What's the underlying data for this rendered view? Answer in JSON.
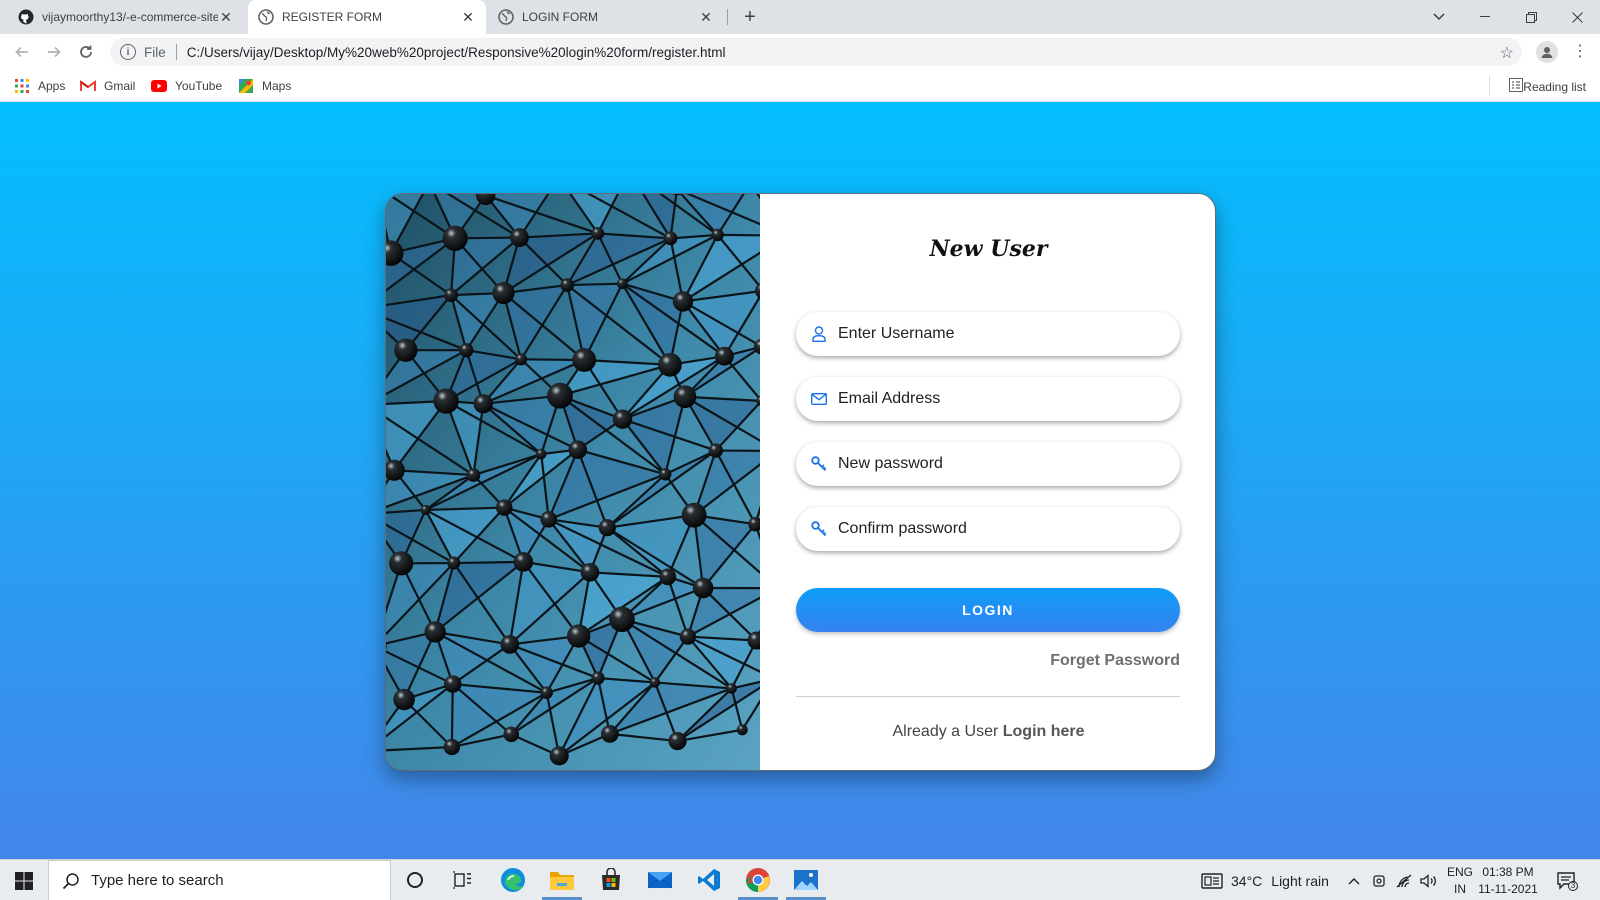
{
  "browser": {
    "tabs": [
      {
        "title": "vijaymoorthy13/-e-commerce-site",
        "icon": "github-icon",
        "active": false
      },
      {
        "title": "REGISTER FORM",
        "icon": "globe-icon",
        "active": true
      },
      {
        "title": "LOGIN FORM",
        "icon": "globe-icon",
        "active": false
      }
    ],
    "address": {
      "scheme_label": "File",
      "url": "C:/Users/vijay/Desktop/My%20web%20project/Responsive%20login%20form/register.html"
    },
    "bookmarks": [
      {
        "label": "Apps",
        "icon": "apps-grid-icon"
      },
      {
        "label": "Gmail",
        "icon": "gmail-icon"
      },
      {
        "label": "YouTube",
        "icon": "youtube-icon"
      },
      {
        "label": "Maps",
        "icon": "maps-icon"
      }
    ],
    "reading_list": "Reading list"
  },
  "form": {
    "title": "New User",
    "fields": [
      {
        "placeholder": "Enter Username",
        "icon": "user-icon",
        "type": "text"
      },
      {
        "placeholder": "Email Address",
        "icon": "mail-icon",
        "type": "email"
      },
      {
        "placeholder": "New password",
        "icon": "key-icon",
        "type": "password"
      },
      {
        "placeholder": "Confirm password",
        "icon": "key-icon",
        "type": "password"
      }
    ],
    "submit_label": "LOGIN",
    "forget_label": "Forget Password",
    "already_text": "Already a User",
    "login_link": "Login here"
  },
  "taskbar": {
    "search_placeholder": "Type here to search",
    "weather_temp": "34°C",
    "weather_desc": "Light rain",
    "lang_top": "ENG",
    "lang_bottom": "IN",
    "time": "01:38 PM",
    "date": "11-11-2021",
    "notification_count": "3"
  },
  "colors": {
    "page_gradient_top": "#03bffe",
    "page_gradient_bottom": "#4386e9",
    "button_blue": "#1a8ef5",
    "icon_blue": "#1a73e8"
  }
}
